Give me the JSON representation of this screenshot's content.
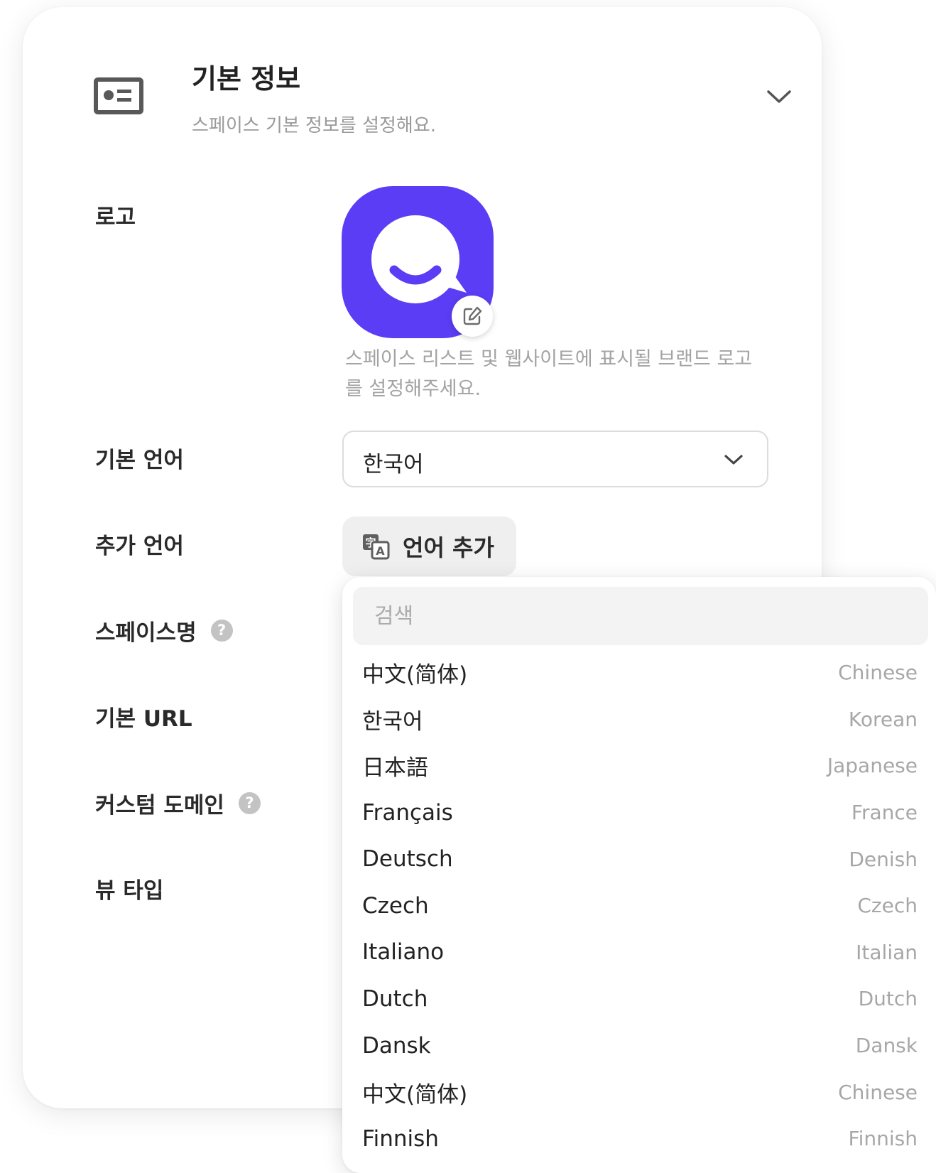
{
  "section": {
    "title": "기본 정보",
    "description": "스페이스 기본 정보를 설정해요."
  },
  "fields": {
    "logo": {
      "label": "로고",
      "help_text": "스페이스 리스트 및 웹사이트에 표시될 브랜드 로고를 설정해주세요."
    },
    "default_language": {
      "label": "기본 언어",
      "value": "한국어"
    },
    "additional_language": {
      "label": "추가 언어",
      "button_label": "언어 추가"
    },
    "space_name": {
      "label": "스페이스명",
      "help_icon": "?"
    },
    "base_url": {
      "label": "기본 URL"
    },
    "custom_domain": {
      "label": "커스텀 도메인",
      "help_icon": "?"
    },
    "view_type": {
      "label": "뷰 타입"
    }
  },
  "language_dropdown": {
    "search_placeholder": "검색",
    "options": [
      {
        "native": "中文(简体)",
        "english": "Chinese"
      },
      {
        "native": "한국어",
        "english": "Korean"
      },
      {
        "native": "日本語",
        "english": "Japanese"
      },
      {
        "native": "Français",
        "english": "France"
      },
      {
        "native": "Deutsch",
        "english": "Denish"
      },
      {
        "native": "Czech",
        "english": "Czech"
      },
      {
        "native": "Italiano",
        "english": "Italian"
      },
      {
        "native": "Dutch",
        "english": "Dutch"
      },
      {
        "native": "Dansk",
        "english": "Dansk"
      },
      {
        "native": "中文(简体)",
        "english": "Chinese"
      },
      {
        "native": "Finnish",
        "english": "Finnish"
      }
    ]
  },
  "icons": {
    "section": "id-card-icon",
    "collapse": "chevron-down-icon",
    "logo_edit": "pencil-edit-icon",
    "select": "chevron-down-icon",
    "add_language": "translate-icon",
    "help": "question-circle-icon"
  },
  "colors": {
    "brand": "#5B3DF5",
    "card_background": "#FFFFFF",
    "muted_text": "#A3A3A3",
    "help_icon": "#C3C3C3",
    "button_background": "#EFEFEF"
  }
}
